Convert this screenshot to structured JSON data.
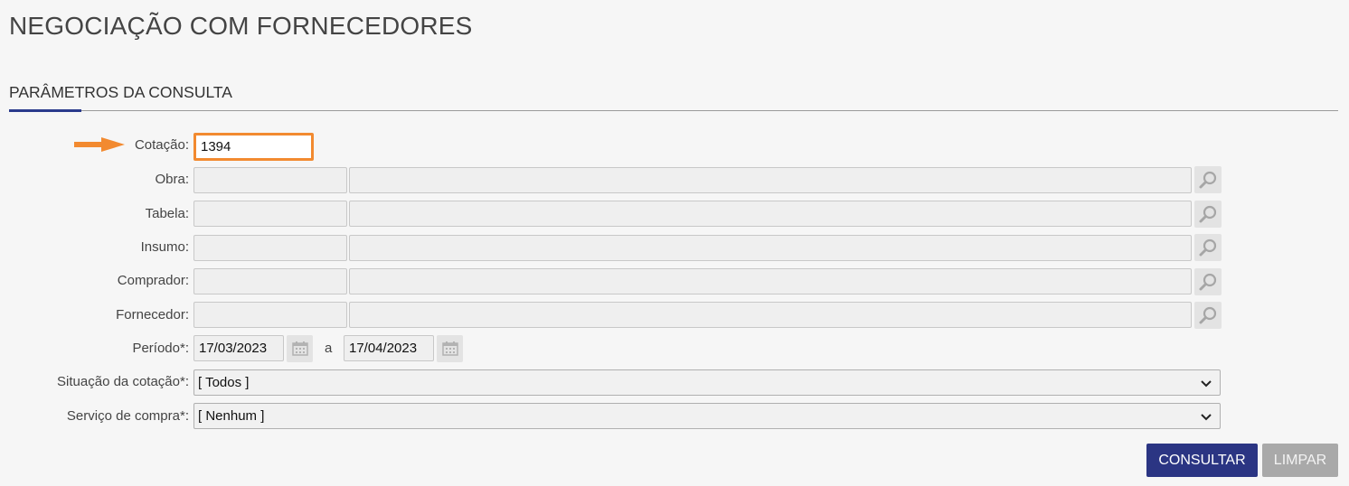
{
  "page": {
    "title": "NEGOCIAÇÃO COM FORNECEDORES"
  },
  "section": {
    "title": "PARÂMETROS DA CONSULTA"
  },
  "form": {
    "cotacao": {
      "label": "Cotação",
      "value": "1394"
    },
    "obra": {
      "label": "Obra"
    },
    "tabela": {
      "label": "Tabela"
    },
    "insumo": {
      "label": "Insumo"
    },
    "comprador": {
      "label": "Comprador"
    },
    "fornecedor": {
      "label": "Fornecedor"
    },
    "periodo": {
      "label": "Período*",
      "start": "17/03/2023",
      "separator": "a",
      "end": "17/04/2023"
    },
    "situacao": {
      "label": "Situação da cotação*",
      "selected": "[ Todos ]"
    },
    "servico": {
      "label": "Serviço de compra*",
      "selected": "[ Nenhum ]"
    },
    "colon": ":"
  },
  "buttons": {
    "consultar": "CONSULTAR",
    "limpar": "LIMPAR"
  },
  "colors": {
    "accent": "#2b3583",
    "highlight": "#f28a30",
    "secondary": "#a9a9a9"
  },
  "icons": {
    "lookup": "search-icon",
    "calendar": "calendar-icon",
    "pointer": "arrow-right-icon",
    "dropdown": "chevron-down-icon"
  }
}
